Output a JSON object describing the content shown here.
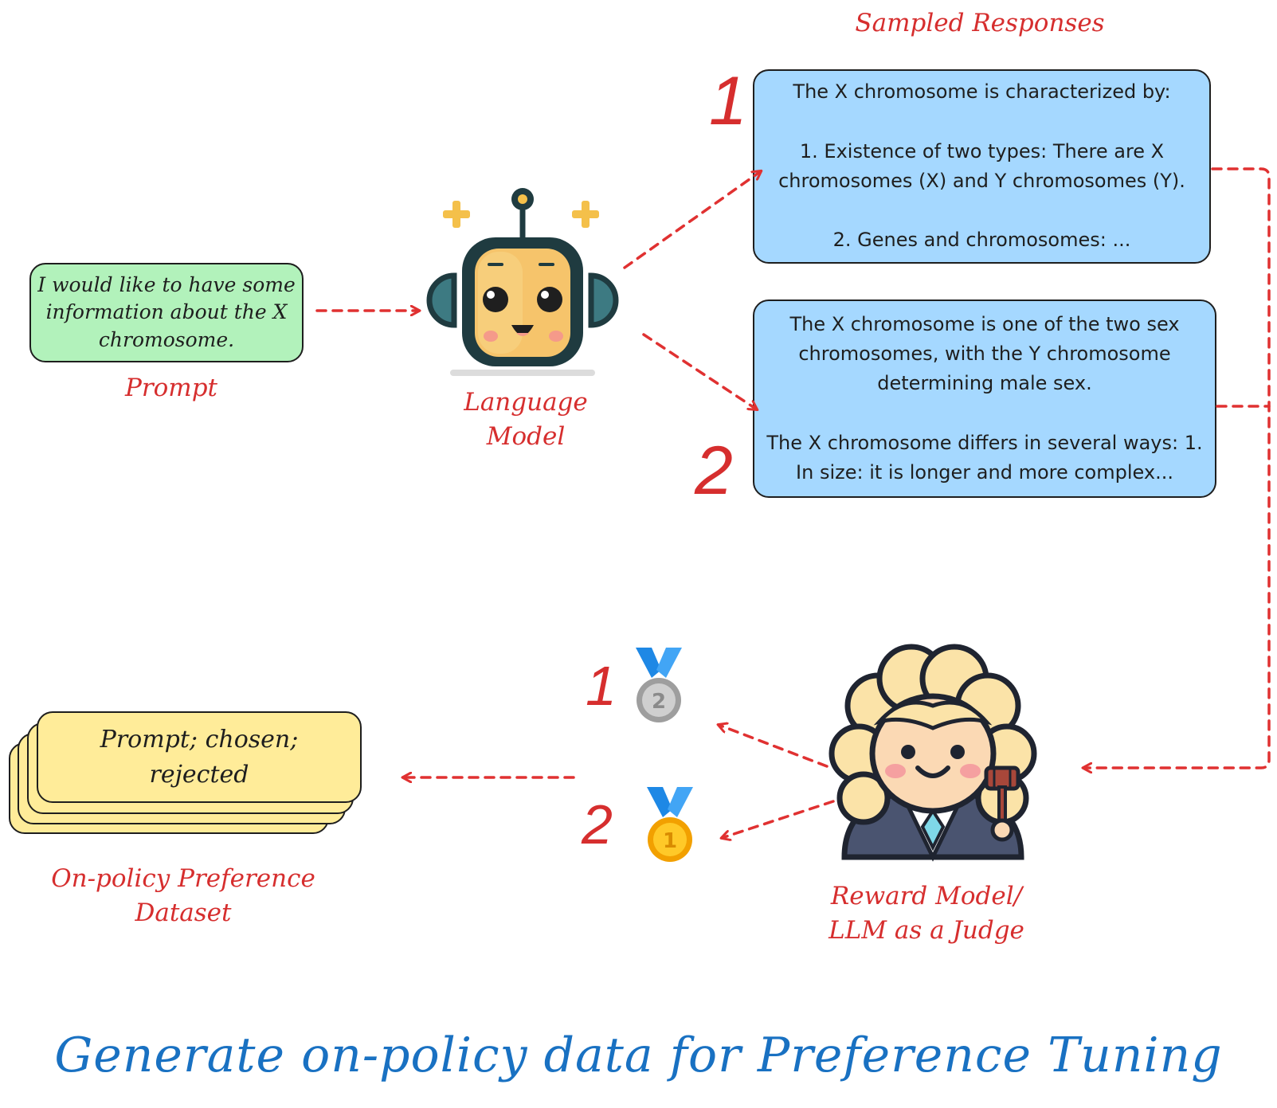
{
  "title": "Generate on-policy data for Preference Tuning",
  "prompt": {
    "text": "I would like to have some information about the X chromosome.",
    "label": "Prompt"
  },
  "language_model": {
    "label": "Language Model"
  },
  "sampled_responses": {
    "label": "Sampled Responses",
    "items": [
      {
        "number": "1",
        "text": "The X chromosome is characterized by:\n\n1. Existence of two types: There are X chromosomes (X) and Y chromosomes (Y).\n\n2. Genes and chromosomes: ..."
      },
      {
        "number": "2",
        "text": "The X chromosome is one of the two sex chromosomes, with the Y chromosome determining male sex.\n\nThe X chromosome differs in several ways: 1. In size: it is longer and more complex..."
      }
    ]
  },
  "judge": {
    "label": "Reward Model/ LLM as a Judge"
  },
  "rankings": [
    {
      "response": "1",
      "medal": "2",
      "medal_icon": "silver-medal-icon"
    },
    {
      "response": "2",
      "medal": "1",
      "medal_icon": "gold-medal-icon"
    }
  ],
  "dataset": {
    "card_text": "Prompt; chosen; rejected",
    "label": "On-policy Preference Dataset"
  },
  "colors": {
    "accent_red": "#d62e2e",
    "title_blue": "#1971c2",
    "prompt_green": "#b2f2bb",
    "response_blue": "#a5d8ff",
    "dataset_yellow": "#ffec99"
  }
}
